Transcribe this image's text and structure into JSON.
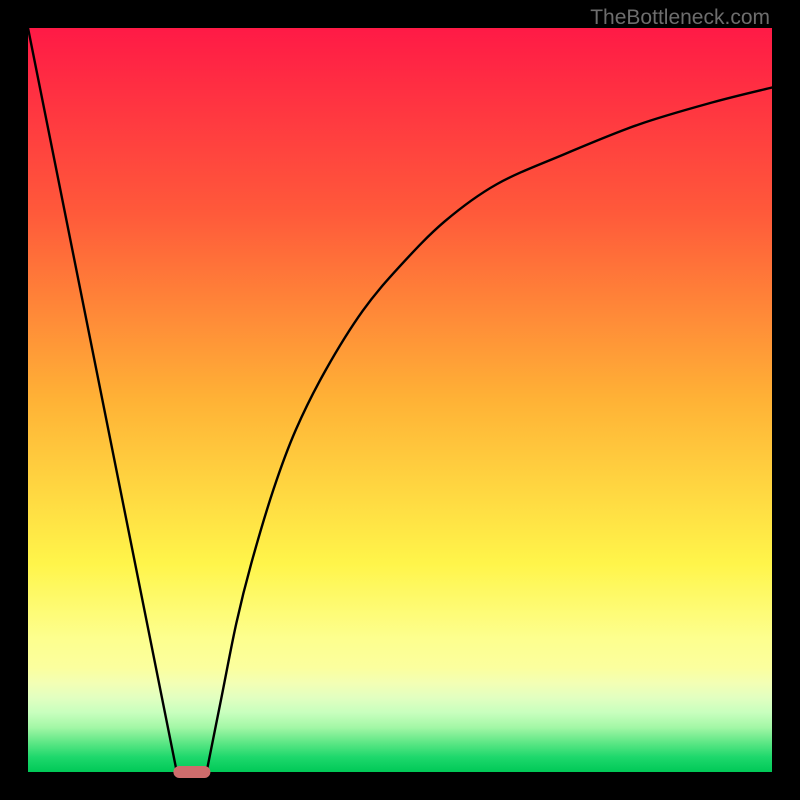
{
  "watermark": "TheBottleneck.com",
  "chart_data": {
    "type": "line",
    "title": "",
    "xlabel": "",
    "ylabel": "",
    "xlim": [
      0,
      100
    ],
    "ylim": [
      0,
      100
    ],
    "axes_visible": false,
    "grid": false,
    "background_gradient": {
      "direction": "vertical",
      "stops": [
        {
          "pos": 0.0,
          "color": "#ff1a46"
        },
        {
          "pos": 0.25,
          "color": "#ff5a3a"
        },
        {
          "pos": 0.5,
          "color": "#ffb236"
        },
        {
          "pos": 0.72,
          "color": "#fff54a"
        },
        {
          "pos": 0.82,
          "color": "#fdff8e"
        },
        {
          "pos": 0.86,
          "color": "#fbff9e"
        },
        {
          "pos": 0.88,
          "color": "#f3ffb4"
        },
        {
          "pos": 0.9,
          "color": "#e2ffc0"
        },
        {
          "pos": 0.92,
          "color": "#c8ffbe"
        },
        {
          "pos": 0.94,
          "color": "#a3f7a6"
        },
        {
          "pos": 0.96,
          "color": "#5fe786"
        },
        {
          "pos": 0.98,
          "color": "#1ed86c"
        },
        {
          "pos": 1.0,
          "color": "#00c957"
        }
      ]
    },
    "series": [
      {
        "name": "left-branch",
        "x": [
          0,
          5,
          10,
          15,
          18,
          20
        ],
        "y": [
          100,
          75,
          50,
          25,
          10,
          0
        ]
      },
      {
        "name": "right-branch",
        "x": [
          24,
          26,
          28,
          30,
          33,
          36,
          40,
          45,
          50,
          56,
          63,
          72,
          82,
          92,
          100
        ],
        "y": [
          0,
          10,
          20,
          28,
          38,
          46,
          54,
          62,
          68,
          74,
          79,
          83,
          87,
          90,
          92
        ]
      }
    ],
    "marker": {
      "shape": "rounded-bar",
      "color": "#ce6c6c",
      "x": 22,
      "y": 0,
      "width_units": 5,
      "height_units": 1.6
    },
    "curve_style": {
      "stroke": "#000000",
      "stroke_width": 2.4
    }
  }
}
